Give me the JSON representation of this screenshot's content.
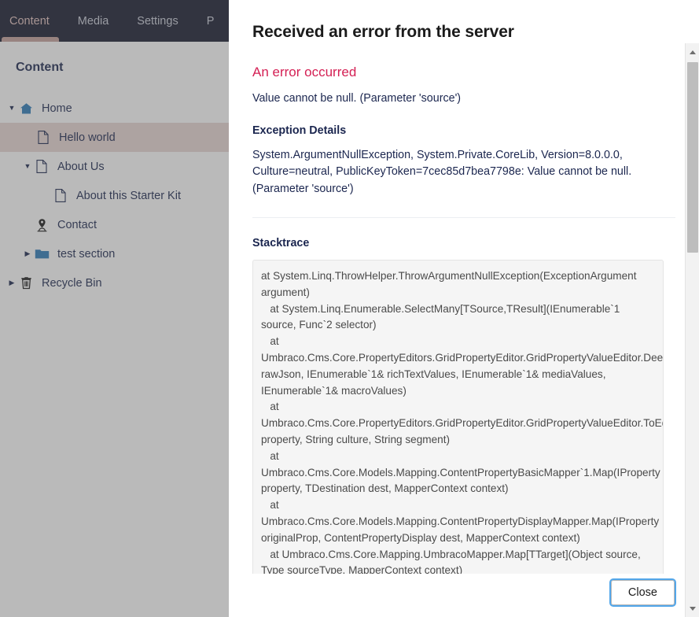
{
  "topnav": {
    "items": [
      {
        "label": "Content",
        "active": true
      },
      {
        "label": "Media",
        "active": false
      },
      {
        "label": "Settings",
        "active": false
      },
      {
        "label": "P",
        "active": false
      }
    ]
  },
  "left_pane": {
    "section_title": "Content",
    "tree": [
      {
        "label": "Home",
        "icon": "home-icon",
        "caret": "expanded",
        "indent": 0,
        "selected": false
      },
      {
        "label": "Hello world",
        "icon": "document-icon",
        "caret": "none",
        "indent": 1,
        "selected": true
      },
      {
        "label": "About Us",
        "icon": "document-icon",
        "caret": "expanded",
        "indent": 1,
        "selected": false
      },
      {
        "label": "About this Starter Kit",
        "icon": "document-icon",
        "caret": "none",
        "indent": 2,
        "selected": false
      },
      {
        "label": "Contact",
        "icon": "location-pin-icon",
        "caret": "none",
        "indent": 1,
        "selected": false
      },
      {
        "label": "test section",
        "icon": "folder-icon",
        "caret": "collapsed",
        "indent": 1,
        "selected": false
      },
      {
        "label": "Recycle Bin",
        "icon": "trash-icon",
        "caret": "collapsed",
        "indent": 0,
        "selected": false
      }
    ]
  },
  "dialog": {
    "title": "Received an error from the server",
    "error_heading": "An error occurred",
    "error_message": "Value cannot be null. (Parameter 'source')",
    "exception_details_label": "Exception Details",
    "exception_details": "System.ArgumentNullException, System.Private.CoreLib, Version=8.0.0.0, Culture=neutral, PublicKeyToken=7cec85d7bea7798e: Value cannot be null. (Parameter 'source')",
    "stacktrace_label": "Stacktrace",
    "stacktrace": "at System.Linq.ThrowHelper.ThrowArgumentNullException(ExceptionArgument argument)\n   at System.Linq.Enumerable.SelectMany[TSource,TResult](IEnumerable`1 source, Func`2 selector)\n   at Umbraco.Cms.Core.PropertyEditors.GridPropertyEditor.GridPropertyValueEditor.DeepParse(String rawJson, IEnumerable`1& richTextValues, IEnumerable`1& mediaValues, IEnumerable`1& macroValues)\n   at Umbraco.Cms.Core.PropertyEditors.GridPropertyEditor.GridPropertyValueEditor.ToEditor(IProperty property, String culture, String segment)\n   at Umbraco.Cms.Core.Models.Mapping.ContentPropertyBasicMapper`1.Map(IProperty property, TDestination dest, MapperContext context)\n   at Umbraco.Cms.Core.Models.Mapping.ContentPropertyDisplayMapper.Map(IProperty originalProp, ContentPropertyDisplay dest, MapperContext context)\n   at Umbraco.Cms.Core.Mapping.UmbracoMapper.Map[TTarget](Object source, Type sourceType, MapperContext context)\n   at Umbraco.Cms.Core.Mapping.UmbracoMapper.Map[TSource,TTarget]",
    "close_label": "Close"
  },
  "scrollbar": {
    "up_icon": "scroll-up-arrow-icon",
    "down_icon": "scroll-down-arrow-icon"
  },
  "colors": {
    "nav_background": "#16192e",
    "active_tab_accent": "#c4a09c",
    "selected_row": "#e9d7d4",
    "error_text": "#d42054",
    "focus_ring": "#53a7ea",
    "tree_icon_blue": "#2b7bb9"
  }
}
